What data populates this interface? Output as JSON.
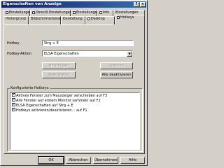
{
  "window": {
    "title": "Eigenschaften von Anzeige",
    "help_button": "?",
    "close_button": "×"
  },
  "tabs_top": [
    {
      "label": "Einstellungen"
    },
    {
      "label": "DirectX Einstellungen"
    },
    {
      "label": "Einstellungen"
    },
    {
      "label": "Info"
    },
    {
      "label": "Einstellungen"
    }
  ],
  "tabs_bottom": [
    {
      "label": "Hintergrund"
    },
    {
      "label": "Bildschirmschoner"
    },
    {
      "label": "Darstellung"
    },
    {
      "label": "Desktop"
    },
    {
      "label": "Hotkeys"
    }
  ],
  "hotkey": {
    "label": "Hotkey",
    "value": "Strg + E"
  },
  "hotkey_action": {
    "label": "Hotkey-Aktion",
    "value": "ELSA Eigenschaften",
    "dropdown_icon": "chevron-down-icon"
  },
  "buttons": {
    "add": "Hinzufügen",
    "delete": "Löschen",
    "deactivate": "deaktivieren",
    "deactivate_all": "Alle deaktivieren"
  },
  "configured": {
    "title": "Konfigurierte Hotkeys:",
    "items": [
      {
        "text": "Aktives Fenster zum Mauszeiger verschieben auf F3",
        "checked": true
      },
      {
        "text": "Alle Fenster auf erstem Monitor sammeln auf F2",
        "checked": true
      },
      {
        "text": "ELSA Eigenschaften auf Strg + E",
        "checked": true
      },
      {
        "text": "Hotkeys aktivieren/deaktivieren... auf F1",
        "checked": true
      }
    ]
  },
  "footer": {
    "ok": "OK",
    "cancel": "Abbrechen",
    "apply": "Übernehmen",
    "help": "Hilfe"
  }
}
